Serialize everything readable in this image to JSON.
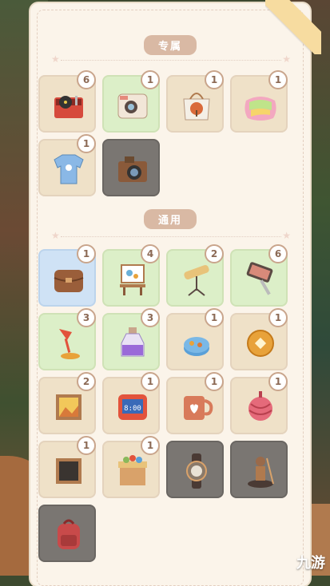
{
  "sections": [
    {
      "title": "专属"
    },
    {
      "title": "通用"
    }
  ],
  "exclusive_items": [
    {
      "icon": "record-player-icon",
      "count": "6",
      "bg": "tan"
    },
    {
      "icon": "instant-camera-icon",
      "count": "1",
      "bg": "green"
    },
    {
      "icon": "tote-bag-icon",
      "count": "1",
      "bg": "tan"
    },
    {
      "icon": "pillow-icon",
      "count": "1",
      "bg": "tan"
    },
    {
      "icon": "tshirt-icon",
      "count": "1",
      "bg": "tan"
    },
    {
      "icon": "camera-icon",
      "count": "",
      "bg": "gray"
    }
  ],
  "common_items": [
    {
      "icon": "wallet-icon",
      "count": "1",
      "bg": "blue"
    },
    {
      "icon": "easel-icon",
      "count": "4",
      "bg": "green"
    },
    {
      "icon": "telescope-icon",
      "count": "2",
      "bg": "green"
    },
    {
      "icon": "phone-stick-icon",
      "count": "6",
      "bg": "green"
    },
    {
      "icon": "desk-lamp-icon",
      "count": "3",
      "bg": "green"
    },
    {
      "icon": "potion-bottle-icon",
      "count": "3",
      "bg": "green"
    },
    {
      "icon": "cookie-tin-icon",
      "count": "1",
      "bg": "tan"
    },
    {
      "icon": "coin-icon",
      "count": "1",
      "bg": "tan"
    },
    {
      "icon": "picture-frame-icon",
      "count": "2",
      "bg": "tan"
    },
    {
      "icon": "alarm-clock-icon",
      "count": "1",
      "bg": "tan",
      "clock": "8:00"
    },
    {
      "icon": "mug-icon",
      "count": "1",
      "bg": "tan"
    },
    {
      "icon": "yarn-ball-icon",
      "count": "1",
      "bg": "tan"
    },
    {
      "icon": "chalkboard-icon",
      "count": "1",
      "bg": "tan"
    },
    {
      "icon": "gift-box-icon",
      "count": "1",
      "bg": "tan"
    },
    {
      "icon": "wristwatch-icon",
      "count": "",
      "bg": "gray"
    },
    {
      "icon": "statue-icon",
      "count": "",
      "bg": "gray"
    },
    {
      "icon": "backpack-icon",
      "count": "",
      "bg": "gray"
    }
  ],
  "watermark": "九游"
}
